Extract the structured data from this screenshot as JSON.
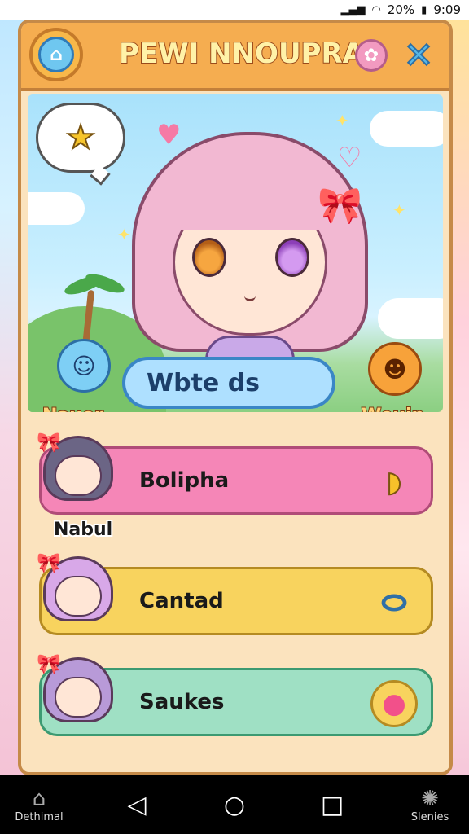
{
  "status_bar": {
    "battery": "20%",
    "time": "9:09"
  },
  "header": {
    "title": "PEWI NNOUPRA"
  },
  "scene": {
    "left_mascot_label": "Nauor",
    "right_mascot_label": "Weuin",
    "center_pill": "Wbte ds"
  },
  "list": {
    "items": [
      {
        "label": "Bolipha",
        "under_label": "Nabul",
        "icon": "banana-icon"
      },
      {
        "label": "Cantad",
        "under_label": "",
        "icon": "candy-icon"
      },
      {
        "label": "Saukes",
        "under_label": "",
        "icon": "ice-cream-icon"
      }
    ]
  },
  "nav": {
    "left_label": "Dethimal",
    "right_label": "Slenies"
  },
  "colors": {
    "header": "#f5ad50",
    "pink_row": "#f586b7",
    "yellow_row": "#f8d35e",
    "green_row": "#9fe0c4",
    "pill": "#aee0ff"
  }
}
